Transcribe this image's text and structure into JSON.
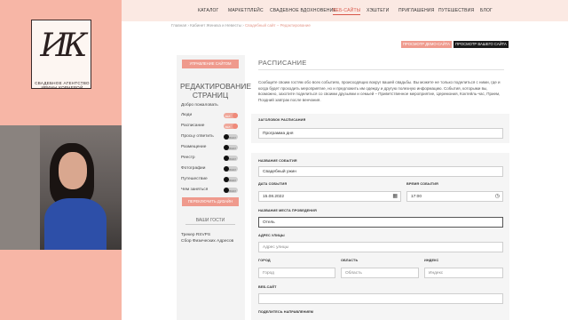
{
  "brand": {
    "logo_letters": "ИК",
    "line1": "СВАДЕБНОЕ АГЕНТСТВО",
    "line2": "ИРИНЫ КОРНЕВОЙ"
  },
  "nav": {
    "items": [
      {
        "label": "КАТАЛОГ",
        "active": false
      },
      {
        "label": "МАРКЕТПЛЕЙС",
        "active": false
      },
      {
        "label": "СВАДЕБНОЕ ВДОХНОВЕНИЕ",
        "active": false
      },
      {
        "label": "ВЕБ-САЙТЫ",
        "active": true
      },
      {
        "label": "ХЭШТЕГИ",
        "active": false
      },
      {
        "label": "ПРИГЛАШЕНИЯ",
        "active": false
      },
      {
        "label": "ПУТЕШЕСТВИЯ",
        "active": false
      },
      {
        "label": "БЛОГ",
        "active": false
      }
    ]
  },
  "breadcrumb": {
    "home": "Главная",
    "sep": "›",
    "cabinet": "Кабинет Жениха и Невесты",
    "current": "Свадебный сайт – Редактирование"
  },
  "actions": {
    "demo": "ПРОСМОТР ДЕМО-САЙТА",
    "view": "ПРОСМОТР ВАШЕГО САЙТА"
  },
  "sidebar": {
    "manage_btn": "УПРАВЛЕНИЕ САЙТОМ",
    "title": "РЕДАКТИРОВАНИЕ СТРАНИЦ",
    "welcome": "Добро пожаловать",
    "pages": [
      {
        "label": "Люди",
        "on": true,
        "state_text": "ВКЛ"
      },
      {
        "label": "Расписание",
        "on": true,
        "state_text": "ВКЛ"
      },
      {
        "label": "Просьу ответить",
        "on": false,
        "state_text": "ВЫКЛ"
      },
      {
        "label": "Размещение",
        "on": false,
        "state_text": "ВЫКЛ"
      },
      {
        "label": "Реестр",
        "on": false,
        "state_text": "ВЫКЛ"
      },
      {
        "label": "Фотографии",
        "on": false,
        "state_text": "ВЫКЛ"
      },
      {
        "label": "Путешествие",
        "on": false,
        "state_text": "ВЫКЛ"
      },
      {
        "label": "Чем заняться",
        "on": false,
        "state_text": "ВЫКЛ"
      }
    ],
    "switch_design": "ПЕРЕКЛЮЧИТЬ ДИЗАЙН",
    "guests_title": "ВАШИ ГОСТИ",
    "tracker": "Трекер RSVPS",
    "address": "Сбор Физических Адресов"
  },
  "content": {
    "title": "РАСПИСАНИЕ",
    "description": "Сообщите своим гостям обо всех событиях, происходящих вокруг вашей свадьбы. Вы можете не только поделиться с ними, где и когда будет проходить мероприятие, но и предложить им одежду и другую полезную информацию. События, которыми вы, возможно, захотите поделиться со своими друзьями и семьей – Приветственное мероприятие, Церемония, Коктейль-час, Прием, Поздний завтрак после венчания.",
    "schedule_heading_label": "ЗАГОЛОВОК РАСПИСАНИЯ",
    "schedule_heading_value": "Программа дня",
    "event_name_label": "НАЗВАНИЕ СОБЫТИЯ",
    "event_name_value": "Свадебный ужин",
    "event_date_label": "ДАТА СОБЫТИЯ",
    "event_date_value": "15.08.2022",
    "event_time_label": "ВРЕМЯ СОБЫТИЯ",
    "event_time_value": "17:00",
    "venue_label": "НАЗВАНИЕ МЕСТА ПРОВЕДЕНИЯ",
    "venue_value": "Отель",
    "street_label": "АДРЕС УЛИЦЫ",
    "street_placeholder": "Адрес улицы",
    "city_label": "ГОРОД",
    "city_placeholder": "Город",
    "region_label": "ОБЛАСТЬ",
    "region_placeholder": "Область",
    "zip_label": "ИНДЕКС",
    "zip_placeholder": "Индекс",
    "website_label": "ВЕБ-САЙТ",
    "directions_label": "ПОДЕЛИТЕСЬ НАПРАВЛЕНИЕМ"
  }
}
